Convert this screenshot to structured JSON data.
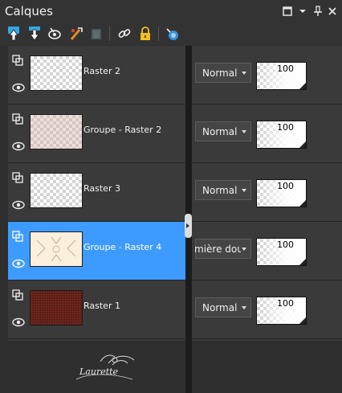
{
  "panel": {
    "title": "Calques"
  },
  "toolbar": {
    "icons": [
      "new-raster-layer-icon",
      "new-vector-layer-icon",
      "new-mask-layer-icon",
      "new-adjustment-layer-icon",
      "merge-layer-icon",
      "link-layers-icon",
      "lock-transparency-icon",
      "layer-highlight-icon"
    ]
  },
  "layers": [
    {
      "name": "Raster 2",
      "blend": "Normal",
      "opacity": "100",
      "thumb": "transparent",
      "selected": false
    },
    {
      "name": "Groupe - Raster 2",
      "blend": "Normal",
      "opacity": "100",
      "thumb": "pink",
      "selected": false
    },
    {
      "name": "Raster 3",
      "blend": "Normal",
      "opacity": "100",
      "thumb": "transparent",
      "selected": false
    },
    {
      "name": "Groupe - Raster 4",
      "blend": "mière dou",
      "opacity": "100",
      "thumb": "cream",
      "selected": true
    },
    {
      "name": "Raster 1",
      "blend": "Normal",
      "opacity": "100",
      "thumb": "dark",
      "selected": false
    }
  ],
  "watermark": {
    "text": "Laurette"
  },
  "colors": {
    "selected": "#3d9bff",
    "panel": "#3a3a3a",
    "background": "#2f2f2f"
  }
}
